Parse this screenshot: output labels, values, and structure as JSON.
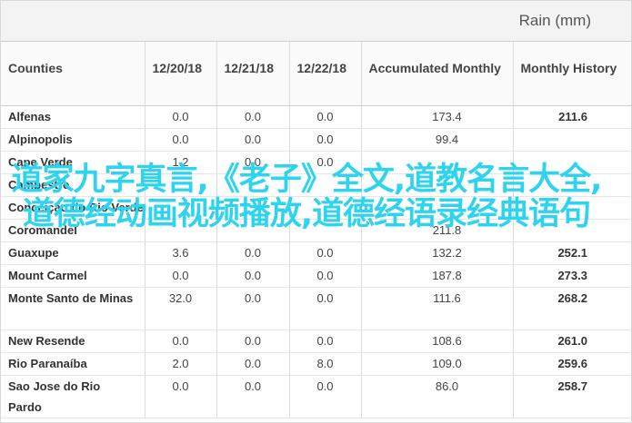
{
  "unit_label": "Rain (mm)",
  "table": {
    "headers": [
      "Counties",
      "12/20/18",
      "12/21/18",
      "12/22/18",
      "Accumulated Monthly",
      "Monthly History"
    ],
    "rows": [
      {
        "county": "Alfenas",
        "d1": "0.0",
        "d2": "0.0",
        "d3": "0.0",
        "accumulated": "173.4",
        "history": "211.6"
      },
      {
        "county": "Alpinopolis",
        "d1": "0.0",
        "d2": "0.0",
        "d3": "0.0",
        "accumulated": "99.4",
        "history": ""
      },
      {
        "county": "Cape Verde",
        "d1": "1.2",
        "d2": "0.0",
        "d3": "0.0",
        "accumulated": "",
        "history": ""
      },
      {
        "county": "Campestre",
        "d1": "",
        "d2": "",
        "d3": "",
        "accumulated": "",
        "history": ""
      },
      {
        "county": "Conceição do Rio Verde",
        "d1": "",
        "d2": "",
        "d3": "",
        "accumulated": "",
        "history": ""
      },
      {
        "county": "Coromandel",
        "d1": "",
        "d2": "",
        "d3": "",
        "accumulated": "211.8",
        "history": ""
      },
      {
        "county": "Guaxupe",
        "d1": "3.6",
        "d2": "0.0",
        "d3": "0.0",
        "accumulated": "132.2",
        "history": "252.1"
      },
      {
        "county": "Mount Carmel",
        "d1": "0.0",
        "d2": "0.0",
        "d3": "0.0",
        "accumulated": "187.8",
        "history": "273.3"
      },
      {
        "county": "Monte Santo de Minas",
        "d1": "32.0",
        "d2": "0.0",
        "d3": "0.0",
        "accumulated": "111.6",
        "history": "268.2"
      },
      {
        "county": "New Resende",
        "d1": "0.0",
        "d2": "0.0",
        "d3": "0.0",
        "accumulated": "108.6",
        "history": "261.0"
      },
      {
        "county": "Rio Paranaíba",
        "d1": "2.0",
        "d2": "0.0",
        "d3": "8.0",
        "accumulated": "109.0",
        "history": "259.6"
      },
      {
        "county": "Sao Jose do Rio Pardo",
        "d1": "0.0",
        "d2": "0.0",
        "d3": "0.0",
        "accumulated": "86.0",
        "history": "258.7"
      }
    ]
  },
  "overlay_text": "道家九字真言,《老子》全文,道教名言大全,道德经动画视频播放,道德经语录经典语句"
}
